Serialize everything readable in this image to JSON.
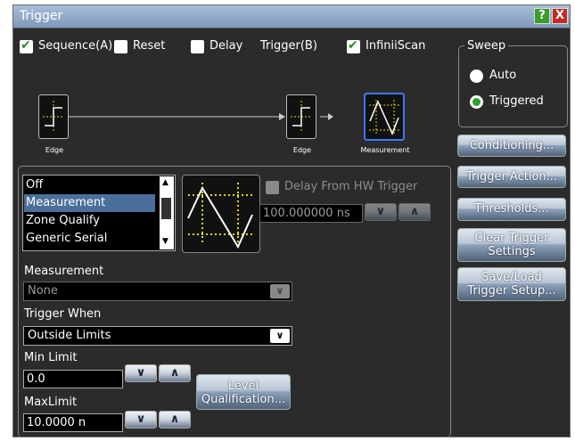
{
  "window": {
    "title": "Trigger",
    "help": "?",
    "close": "X"
  },
  "top_options": {
    "sequence": {
      "label": "Sequence(A)",
      "checked": true
    },
    "reset": {
      "label": "Reset",
      "checked": false
    },
    "delay": {
      "label": "Delay",
      "checked": false
    },
    "trigger_b": {
      "label": "Trigger(B)"
    },
    "infiniiscan": {
      "label": "InfiniiScan",
      "checked": true
    }
  },
  "sweep": {
    "title": "Sweep",
    "auto": "Auto",
    "triggered": "Triggered",
    "selected": "Triggered"
  },
  "sequence_diagram": {
    "edge1": "Edge",
    "edge2": "Edge",
    "measurement": "Measurement"
  },
  "side_buttons": {
    "conditioning": "Conditioning...",
    "trigger_action": "Trigger Action...",
    "thresholds": "Thresholds...",
    "clear_line1": "Clear Trigger",
    "clear_line2": "Settings",
    "save_line1": "Save/Load",
    "save_line2": "Trigger Setup..."
  },
  "trigger_types": [
    "Off",
    "Measurement",
    "Zone Qualify",
    "Generic Serial"
  ],
  "selected_type": "Measurement",
  "delay_hw": {
    "label": "Delay From HW Trigger",
    "value": "100.000000 ns"
  },
  "measurement": {
    "label": "Measurement",
    "value": "None"
  },
  "trigger_when": {
    "label": "Trigger When",
    "value": "Outside Limits"
  },
  "min_limit": {
    "label": "Min Limit",
    "value": "0.0"
  },
  "max_limit": {
    "label": "MaxLimit",
    "value": "10.0000 n"
  },
  "level_qualification": {
    "line1": "Level",
    "line2": "Qualification..."
  },
  "colors": {
    "accent_yellow": "#e8d800",
    "selection_blue": "#4b6f9b",
    "check_green": "#2a8a2a"
  }
}
